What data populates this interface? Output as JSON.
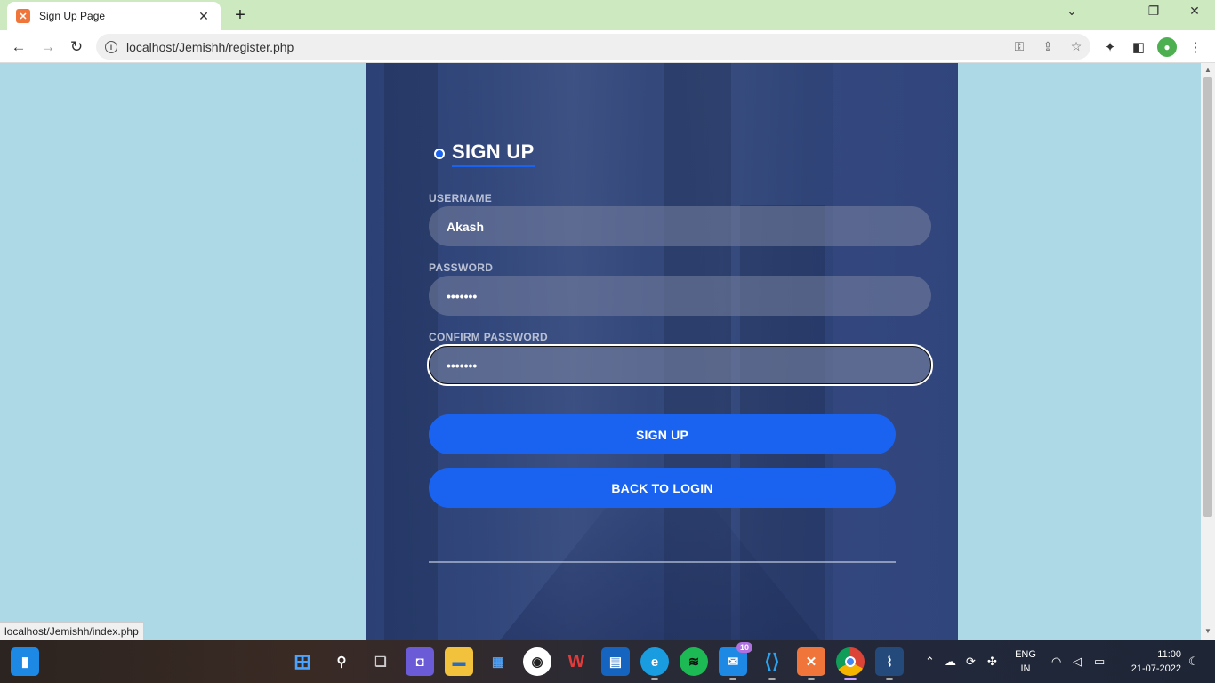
{
  "browser": {
    "tab_title": "Sign Up Page",
    "tab_close": "✕",
    "new_tab": "+",
    "url": "localhost/Jemishh/register.php",
    "status_url": "localhost/Jemishh/index.php"
  },
  "form": {
    "heading": "SIGN UP",
    "username_label": "USERNAME",
    "username_value": "Akash",
    "password_label": "PASSWORD",
    "password_value": "•••••••",
    "confirm_label": "CONFIRM PASSWORD",
    "confirm_value": "•••••••",
    "signup_button": "SIGN UP",
    "back_button": "BACK TO LOGIN"
  },
  "taskbar": {
    "mail_badge": "10",
    "lang_line1": "ENG",
    "lang_line2": "IN",
    "time": "11:00",
    "date": "21-07-2022"
  },
  "colors": {
    "page_bg": "#add8e6",
    "accent": "#1a63f0",
    "panel": "#2f4577"
  }
}
